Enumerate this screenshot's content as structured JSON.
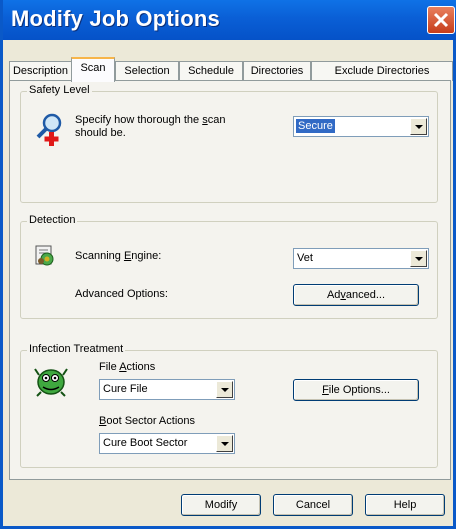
{
  "window": {
    "title": "Modify Job Options"
  },
  "tabs": [
    {
      "label": "Description"
    },
    {
      "label": "Scan"
    },
    {
      "label": "Selection"
    },
    {
      "label": "Schedule"
    },
    {
      "label": "Directories"
    },
    {
      "label": "Exclude Directories"
    }
  ],
  "safety_level": {
    "group_label": "Safety Level",
    "description_line1_pre": "Specify how thorough the ",
    "description_line1_ul": "s",
    "description_line1_post": "can",
    "description_line2": "should be.",
    "selected_value": "Secure",
    "icon": "magnifier-plus-icon"
  },
  "detection": {
    "group_label": "Detection",
    "engine_label_pre": "Scanning ",
    "engine_label_ul": "E",
    "engine_label_post": "ngine:",
    "engine_value": "Vet",
    "advanced_label": "Advanced Options:",
    "advanced_button_pre": "Ad",
    "advanced_button_ul": "v",
    "advanced_button_post": "anced...",
    "icon": "scan-engine-icon"
  },
  "infection_treatment": {
    "group_label": "Infection Treatment",
    "file_actions_label_pre": "File ",
    "file_actions_label_ul": "A",
    "file_actions_label_post": "ctions",
    "file_actions_value": "Cure File",
    "file_options_button_ul": "F",
    "file_options_button_post": "ile Options...",
    "boot_label_ul": "B",
    "boot_label_post": "oot Sector Actions",
    "boot_value": "Cure Boot Sector",
    "icon": "virus-creature-icon"
  },
  "buttons": {
    "modify": "Modify",
    "cancel": "Cancel",
    "help": "Help"
  }
}
